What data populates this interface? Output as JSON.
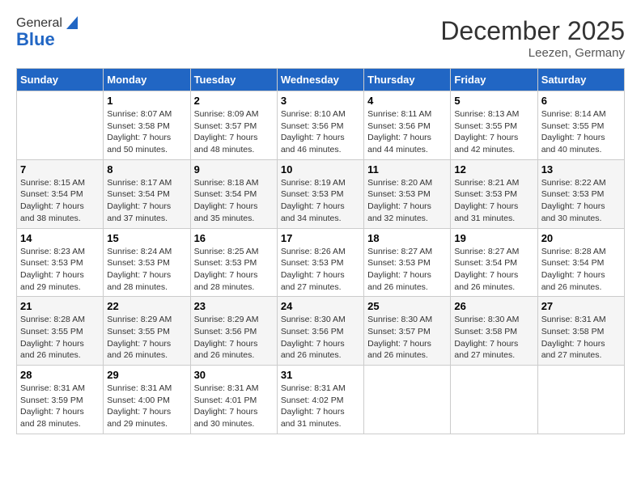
{
  "header": {
    "logo_general": "General",
    "logo_blue": "Blue",
    "month": "December 2025",
    "location": "Leezen, Germany"
  },
  "weekdays": [
    "Sunday",
    "Monday",
    "Tuesday",
    "Wednesday",
    "Thursday",
    "Friday",
    "Saturday"
  ],
  "weeks": [
    [
      {
        "day": "",
        "sunrise": "",
        "sunset": "",
        "daylight": ""
      },
      {
        "day": "1",
        "sunrise": "Sunrise: 8:07 AM",
        "sunset": "Sunset: 3:58 PM",
        "daylight": "Daylight: 7 hours and 50 minutes."
      },
      {
        "day": "2",
        "sunrise": "Sunrise: 8:09 AM",
        "sunset": "Sunset: 3:57 PM",
        "daylight": "Daylight: 7 hours and 48 minutes."
      },
      {
        "day": "3",
        "sunrise": "Sunrise: 8:10 AM",
        "sunset": "Sunset: 3:56 PM",
        "daylight": "Daylight: 7 hours and 46 minutes."
      },
      {
        "day": "4",
        "sunrise": "Sunrise: 8:11 AM",
        "sunset": "Sunset: 3:56 PM",
        "daylight": "Daylight: 7 hours and 44 minutes."
      },
      {
        "day": "5",
        "sunrise": "Sunrise: 8:13 AM",
        "sunset": "Sunset: 3:55 PM",
        "daylight": "Daylight: 7 hours and 42 minutes."
      },
      {
        "day": "6",
        "sunrise": "Sunrise: 8:14 AM",
        "sunset": "Sunset: 3:55 PM",
        "daylight": "Daylight: 7 hours and 40 minutes."
      }
    ],
    [
      {
        "day": "7",
        "sunrise": "Sunrise: 8:15 AM",
        "sunset": "Sunset: 3:54 PM",
        "daylight": "Daylight: 7 hours and 38 minutes."
      },
      {
        "day": "8",
        "sunrise": "Sunrise: 8:17 AM",
        "sunset": "Sunset: 3:54 PM",
        "daylight": "Daylight: 7 hours and 37 minutes."
      },
      {
        "day": "9",
        "sunrise": "Sunrise: 8:18 AM",
        "sunset": "Sunset: 3:54 PM",
        "daylight": "Daylight: 7 hours and 35 minutes."
      },
      {
        "day": "10",
        "sunrise": "Sunrise: 8:19 AM",
        "sunset": "Sunset: 3:53 PM",
        "daylight": "Daylight: 7 hours and 34 minutes."
      },
      {
        "day": "11",
        "sunrise": "Sunrise: 8:20 AM",
        "sunset": "Sunset: 3:53 PM",
        "daylight": "Daylight: 7 hours and 32 minutes."
      },
      {
        "day": "12",
        "sunrise": "Sunrise: 8:21 AM",
        "sunset": "Sunset: 3:53 PM",
        "daylight": "Daylight: 7 hours and 31 minutes."
      },
      {
        "day": "13",
        "sunrise": "Sunrise: 8:22 AM",
        "sunset": "Sunset: 3:53 PM",
        "daylight": "Daylight: 7 hours and 30 minutes."
      }
    ],
    [
      {
        "day": "14",
        "sunrise": "Sunrise: 8:23 AM",
        "sunset": "Sunset: 3:53 PM",
        "daylight": "Daylight: 7 hours and 29 minutes."
      },
      {
        "day": "15",
        "sunrise": "Sunrise: 8:24 AM",
        "sunset": "Sunset: 3:53 PM",
        "daylight": "Daylight: 7 hours and 28 minutes."
      },
      {
        "day": "16",
        "sunrise": "Sunrise: 8:25 AM",
        "sunset": "Sunset: 3:53 PM",
        "daylight": "Daylight: 7 hours and 28 minutes."
      },
      {
        "day": "17",
        "sunrise": "Sunrise: 8:26 AM",
        "sunset": "Sunset: 3:53 PM",
        "daylight": "Daylight: 7 hours and 27 minutes."
      },
      {
        "day": "18",
        "sunrise": "Sunrise: 8:27 AM",
        "sunset": "Sunset: 3:53 PM",
        "daylight": "Daylight: 7 hours and 26 minutes."
      },
      {
        "day": "19",
        "sunrise": "Sunrise: 8:27 AM",
        "sunset": "Sunset: 3:54 PM",
        "daylight": "Daylight: 7 hours and 26 minutes."
      },
      {
        "day": "20",
        "sunrise": "Sunrise: 8:28 AM",
        "sunset": "Sunset: 3:54 PM",
        "daylight": "Daylight: 7 hours and 26 minutes."
      }
    ],
    [
      {
        "day": "21",
        "sunrise": "Sunrise: 8:28 AM",
        "sunset": "Sunset: 3:55 PM",
        "daylight": "Daylight: 7 hours and 26 minutes."
      },
      {
        "day": "22",
        "sunrise": "Sunrise: 8:29 AM",
        "sunset": "Sunset: 3:55 PM",
        "daylight": "Daylight: 7 hours and 26 minutes."
      },
      {
        "day": "23",
        "sunrise": "Sunrise: 8:29 AM",
        "sunset": "Sunset: 3:56 PM",
        "daylight": "Daylight: 7 hours and 26 minutes."
      },
      {
        "day": "24",
        "sunrise": "Sunrise: 8:30 AM",
        "sunset": "Sunset: 3:56 PM",
        "daylight": "Daylight: 7 hours and 26 minutes."
      },
      {
        "day": "25",
        "sunrise": "Sunrise: 8:30 AM",
        "sunset": "Sunset: 3:57 PM",
        "daylight": "Daylight: 7 hours and 26 minutes."
      },
      {
        "day": "26",
        "sunrise": "Sunrise: 8:30 AM",
        "sunset": "Sunset: 3:58 PM",
        "daylight": "Daylight: 7 hours and 27 minutes."
      },
      {
        "day": "27",
        "sunrise": "Sunrise: 8:31 AM",
        "sunset": "Sunset: 3:58 PM",
        "daylight": "Daylight: 7 hours and 27 minutes."
      }
    ],
    [
      {
        "day": "28",
        "sunrise": "Sunrise: 8:31 AM",
        "sunset": "Sunset: 3:59 PM",
        "daylight": "Daylight: 7 hours and 28 minutes."
      },
      {
        "day": "29",
        "sunrise": "Sunrise: 8:31 AM",
        "sunset": "Sunset: 4:00 PM",
        "daylight": "Daylight: 7 hours and 29 minutes."
      },
      {
        "day": "30",
        "sunrise": "Sunrise: 8:31 AM",
        "sunset": "Sunset: 4:01 PM",
        "daylight": "Daylight: 7 hours and 30 minutes."
      },
      {
        "day": "31",
        "sunrise": "Sunrise: 8:31 AM",
        "sunset": "Sunset: 4:02 PM",
        "daylight": "Daylight: 7 hours and 31 minutes."
      },
      {
        "day": "",
        "sunrise": "",
        "sunset": "",
        "daylight": ""
      },
      {
        "day": "",
        "sunrise": "",
        "sunset": "",
        "daylight": ""
      },
      {
        "day": "",
        "sunrise": "",
        "sunset": "",
        "daylight": ""
      }
    ]
  ]
}
